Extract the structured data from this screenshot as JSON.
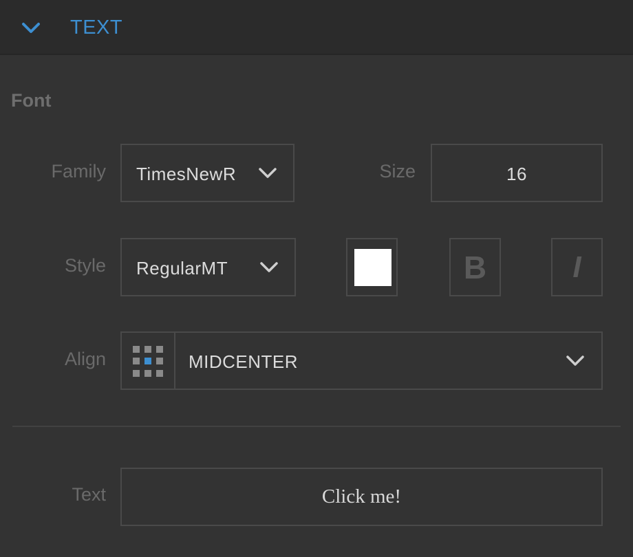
{
  "header": {
    "title": "TEXT",
    "collapse_icon": "chevron-down-icon",
    "accent_color": "#3d8fd1"
  },
  "font_section": {
    "title": "Font",
    "family": {
      "label": "Family",
      "value": "TimesNewR"
    },
    "size": {
      "label": "Size",
      "value": "16"
    },
    "style": {
      "label": "Style",
      "value": "RegularMT",
      "color_swatch": "#ffffff",
      "bold_label": "B",
      "italic_label": "I"
    },
    "align": {
      "label": "Align",
      "value": "MIDCENTER",
      "grid_icon": "alignment-grid-icon",
      "selected_cell": "middle-center"
    }
  },
  "text_section": {
    "label": "Text",
    "value": "Click me!"
  }
}
